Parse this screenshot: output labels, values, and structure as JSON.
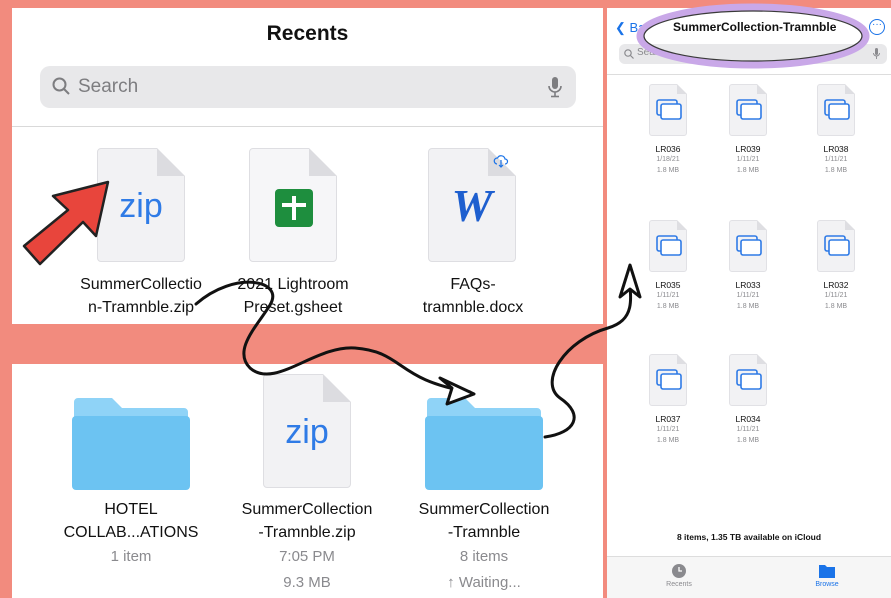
{
  "recents": {
    "title": "Recents",
    "search_placeholder": "Search",
    "files": [
      {
        "name_line1": "SummerCollectio",
        "name_line2": "n-Tramnble.zip",
        "badge": "zip"
      },
      {
        "name_line1": "2021 Lightroom",
        "name_line2": "Preset.gsheet"
      },
      {
        "name_line1": "FAQs-",
        "name_line2": "tramnble.docx",
        "badge": "W"
      }
    ]
  },
  "browse": {
    "items": [
      {
        "line1": "HOTEL",
        "line2": "COLLAB...ATIONS",
        "meta1": "1 item"
      },
      {
        "line1": "SummerCollection",
        "line2": "-Tramnble.zip",
        "meta1": "7:05 PM",
        "meta2": "9.3 MB",
        "badge": "zip"
      },
      {
        "line1": "SummerCollection",
        "line2": "-Tramnble",
        "meta1": "8 items",
        "meta2": "↑ Waiting..."
      }
    ]
  },
  "folder_view": {
    "back_label": "Ba",
    "title": "SummerCollection-Tramnble",
    "search_placeholder": "Searc",
    "files": [
      {
        "name": "LR036",
        "date": "1/18/21",
        "size": "1.8 MB"
      },
      {
        "name": "LR039",
        "date": "1/11/21",
        "size": "1.8 MB"
      },
      {
        "name": "LR038",
        "date": "1/11/21",
        "size": "1.8 MB"
      },
      {
        "name": "LR035",
        "date": "1/11/21",
        "size": "1.8 MB"
      },
      {
        "name": "LR033",
        "date": "1/11/21",
        "size": "1.8 MB"
      },
      {
        "name": "LR032",
        "date": "1/11/21",
        "size": "1.8 MB"
      },
      {
        "name": "LR037",
        "date": "1/11/21",
        "size": "1.8 MB"
      },
      {
        "name": "LR034",
        "date": "1/11/21",
        "size": "1.8 MB"
      }
    ],
    "status": "8 items, 1.35 TB available on iCloud",
    "tabs": [
      {
        "label": "Recents",
        "icon": "clock-icon"
      },
      {
        "label": "Browse",
        "icon": "folder-icon"
      }
    ]
  },
  "colors": {
    "background": "#F28B7E",
    "accent": "#1a73e8",
    "folder": "#7FCBF5"
  }
}
